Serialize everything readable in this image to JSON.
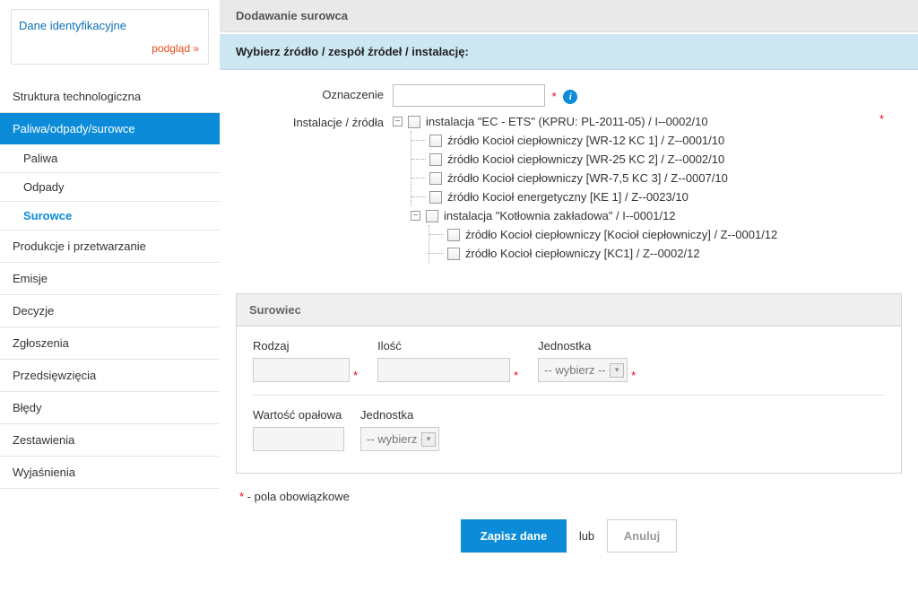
{
  "sidebar": {
    "ident_title": "Dane identyfikacyjne",
    "podglad": "podgląd »",
    "items": [
      {
        "label": "Struktura technologiczna",
        "active": false
      },
      {
        "label": "Paliwa/odpady/surowce",
        "active": true
      },
      {
        "label": "Produkcje i przetwarzanie",
        "active": false
      },
      {
        "label": "Emisje",
        "active": false
      },
      {
        "label": "Decyzje",
        "active": false
      },
      {
        "label": "Zgłoszenia",
        "active": false
      },
      {
        "label": "Przedsięwzięcia",
        "active": false
      },
      {
        "label": "Błędy",
        "active": false
      },
      {
        "label": "Zestawienia",
        "active": false
      },
      {
        "label": "Wyjaśnienia",
        "active": false
      }
    ],
    "subitems": [
      {
        "label": "Paliwa",
        "active": false
      },
      {
        "label": "Odpady",
        "active": false
      },
      {
        "label": "Surowce",
        "active": true
      }
    ]
  },
  "main": {
    "page_title": "Dodawanie surowca",
    "section_title": "Wybierz źródło / zespół źródeł / instalację:",
    "labels": {
      "oznaczenie": "Oznaczenie",
      "instalacje": "Instalacje / źródła"
    },
    "tree": [
      {
        "label": "instalacja \"EC - ETS\" (KPRU: PL-2011-05) / I--0002/10",
        "children": [
          "źródło Kocioł ciepłowniczy [WR-12 KC 1] / Z--0001/10",
          "źródło Kocioł ciepłowniczy [WR-25 KC 2] / Z--0002/10",
          "źródło Kocioł ciepłowniczy [WR-7,5 KC 3] / Z--0007/10",
          "źródło Kocioł energetyczny [KE 1] / Z--0023/10"
        ]
      },
      {
        "label": "instalacja \"Kotłownia zakładowa\" / I--0001/12",
        "children": [
          "źródło Kocioł ciepłowniczy [Kocioł ciepłowniczy] / Z--0001/12",
          "źródło Kocioł ciepłowniczy [KC1] / Z--0002/12"
        ]
      }
    ],
    "panel": {
      "title": "Surowiec",
      "rodzaj": "Rodzaj",
      "ilosc": "Ilość",
      "jednostka": "Jednostka",
      "wartosc": "Wartość opałowa",
      "select_placeholder": "-- wybierz --"
    },
    "note_symbol": "*",
    "note_text": " - pola obowiązkowe",
    "actions": {
      "save": "Zapisz dane",
      "or": "lub",
      "cancel": "Anuluj"
    }
  }
}
